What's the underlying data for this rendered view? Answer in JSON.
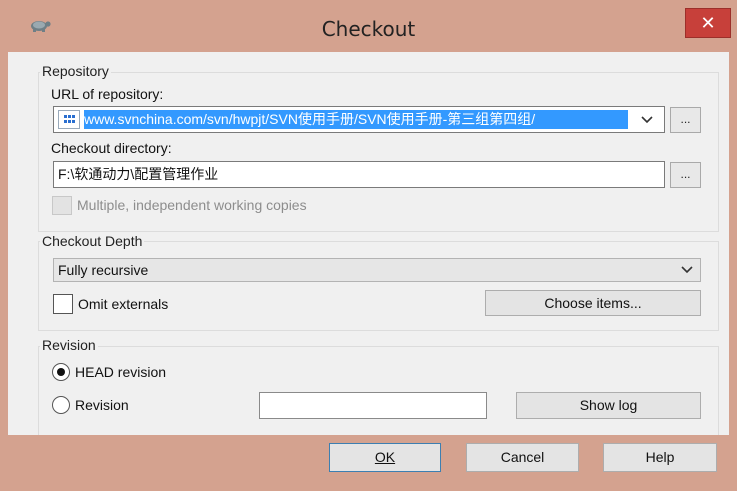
{
  "window": {
    "title": "Checkout",
    "close_glyph": "✕",
    "app_icon": "tortoisesvn-turtle-icon"
  },
  "repository": {
    "group_label": "Repository",
    "url_label": "URL of repository:",
    "url_value": "www.svnchina.com/svn/hwpjt/SVN使用手册/SVN使用手册-第三组第四组/",
    "url_icon": "url-scheme-icon",
    "browse_label": "...",
    "dir_label": "Checkout directory:",
    "dir_value": "F:\\软通动力\\配置管理作业",
    "multiple_label": "Multiple, independent working copies"
  },
  "depth": {
    "group_label": "Checkout Depth",
    "selected": "Fully recursive",
    "omit_label": "Omit externals",
    "choose_label": "Choose items..."
  },
  "revision": {
    "group_label": "Revision",
    "head_label": "HEAD revision",
    "revision_label": "Revision",
    "revision_value": "",
    "show_log_label": "Show log"
  },
  "buttons": {
    "ok_label": "OK",
    "cancel_label": "Cancel",
    "help_label": "Help"
  }
}
